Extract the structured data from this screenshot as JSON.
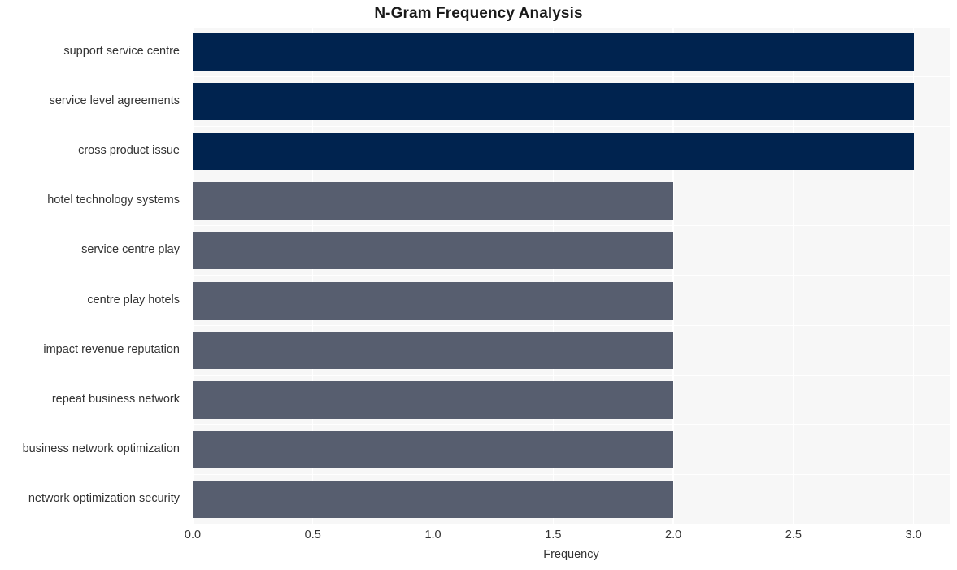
{
  "chart_data": {
    "type": "bar",
    "orientation": "horizontal",
    "title": "N-Gram Frequency Analysis",
    "xlabel": "Frequency",
    "ylabel": "",
    "categories": [
      "support service centre",
      "service level agreements",
      "cross product issue",
      "hotel technology systems",
      "service centre play",
      "centre play hotels",
      "impact revenue reputation",
      "repeat business network",
      "business network optimization",
      "network optimization security"
    ],
    "values": [
      3,
      3,
      3,
      2,
      2,
      2,
      2,
      2,
      2,
      2
    ],
    "bar_colors": [
      "#00234f",
      "#00234f",
      "#00234f",
      "#575e6f",
      "#575e6f",
      "#575e6f",
      "#575e6f",
      "#575e6f",
      "#575e6f",
      "#575e6f"
    ],
    "xlim": [
      0.0,
      3.15
    ],
    "xticks": [
      0.0,
      0.5,
      1.0,
      1.5,
      2.0,
      2.5,
      3.0
    ],
    "xtick_labels": [
      "0.0",
      "0.5",
      "1.0",
      "1.5",
      "2.0",
      "2.5",
      "3.0"
    ],
    "grid": true,
    "grid_color": "#ffffff",
    "plot_background": "#f7f7f7",
    "figure_background": "#ffffff",
    "legend": null,
    "legend_position": "none"
  },
  "colors": {
    "accent_primary": "#00234f",
    "accent_secondary": "#575e6f",
    "plot_bg": "#f7f7f7",
    "grid": "#ffffff",
    "text": "#333333",
    "title": "#1a1a1a"
  }
}
